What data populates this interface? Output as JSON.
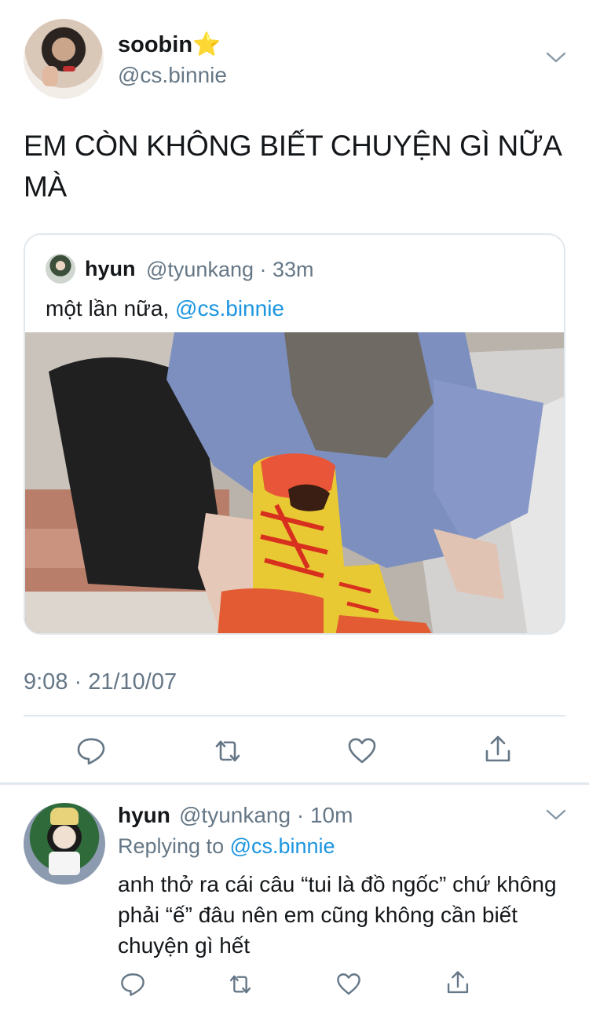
{
  "tweet": {
    "author_name": "soobin⭐",
    "author_handle": "@cs.binnie",
    "text": "EM CÒN KHÔNG BIẾT CHUYỆN GÌ NỮA MÀ",
    "timestamp": "9:08 · 21/10/07"
  },
  "quoted": {
    "author_name": "hyun",
    "author_meta": "@tyunkang · 33m",
    "text": "một lần nữa, ",
    "mention": "@cs.binnie"
  },
  "reply": {
    "author_name": "hyun",
    "author_meta": "@tyunkang · 10m",
    "replying_label": "Replying to ",
    "replying_mention": "@cs.binnie",
    "text": "anh thở ra cái câu “tui là đồ ngốc” chứ không phải “ế” đâu nên em cũng không cần biết chuyện gì hết"
  },
  "icons": [
    "chevron-down-icon",
    "reply-icon",
    "retweet-icon",
    "like-icon",
    "share-icon"
  ],
  "colors": {
    "link": "#1b95e0",
    "secondary": "#657786",
    "border": "#e1e8ed"
  }
}
